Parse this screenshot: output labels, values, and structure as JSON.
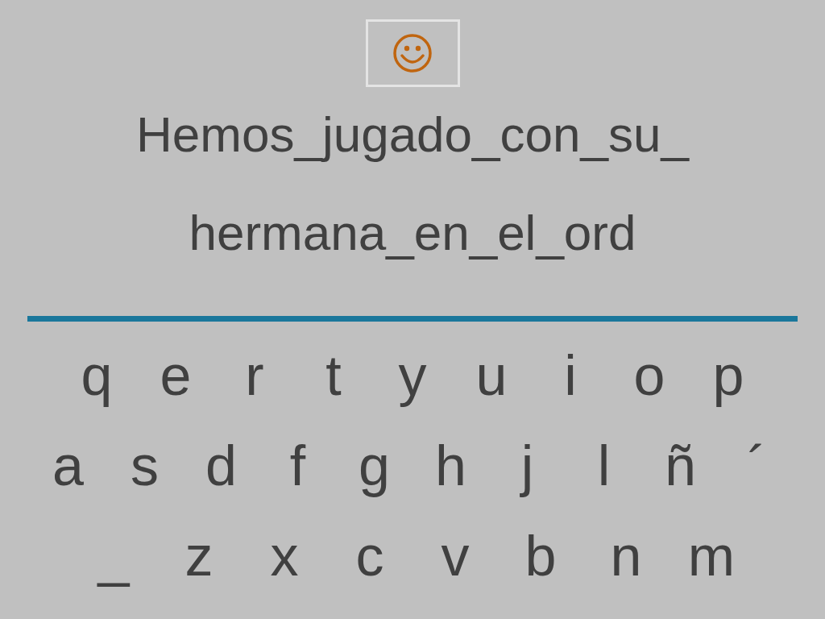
{
  "feedback": {
    "kind": "smiley"
  },
  "sentence_lines": [
    "Hemos_jugado_con_su_",
    "hermana_en_el_ord"
  ],
  "keyboard_rows": [
    [
      "q",
      "e",
      "r",
      "t",
      "y",
      "u",
      "i",
      "o",
      "p"
    ],
    [
      "a",
      "s",
      "d",
      "f",
      "g",
      "h",
      "j",
      "l",
      "ñ",
      "´"
    ],
    [
      "_",
      "z",
      "x",
      "c",
      "v",
      "b",
      "n",
      "m"
    ]
  ]
}
